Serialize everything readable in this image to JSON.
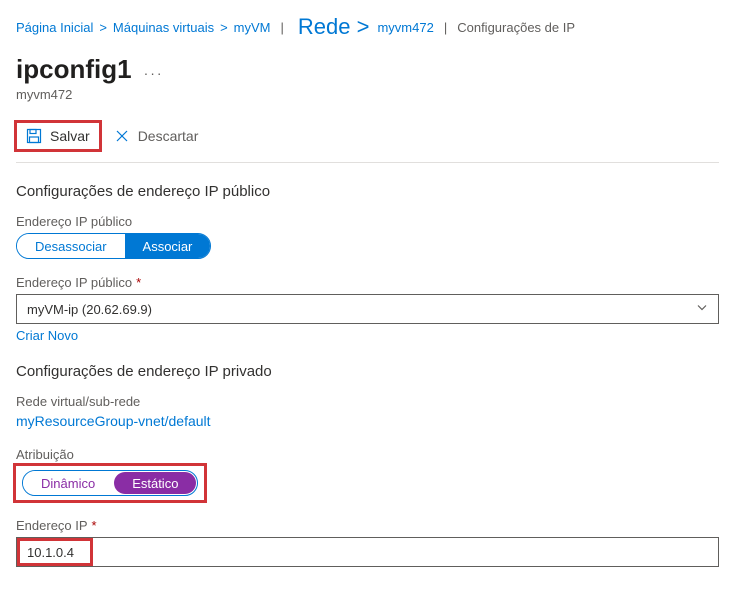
{
  "breadcrumbs": {
    "home": "Página Inicial",
    "vms": "Máquinas virtuais",
    "vm_name": "myVM",
    "network_highlight": "Rede >",
    "nic": "myvm472",
    "current": "Configurações de IP"
  },
  "header": {
    "title": "ipconfig1",
    "subtitle": "myvm472"
  },
  "toolbar": {
    "save_label": "Salvar",
    "discard_label": "Descartar"
  },
  "public_ip_section": {
    "heading": "Configurações de endereço IP público",
    "label_public_ip": "Endereço IP público",
    "disassociate": "Desassociar",
    "associate": "Associar",
    "label_public_ip_select": "Endereço IP público",
    "selected_ip": "myVM-ip (20.62.69.9)",
    "create_new": "Criar Novo"
  },
  "private_ip_section": {
    "heading": "Configurações de endereço IP privado",
    "vnet_label": "Rede virtual/sub-rede",
    "vnet_value": "myResourceGroup-vnet/default",
    "assignment_label": "Atribuição",
    "dynamic": "Dinâmico",
    "static": "Estático",
    "ip_label": "Endereço IP",
    "ip_value": "10.1.0.4"
  }
}
